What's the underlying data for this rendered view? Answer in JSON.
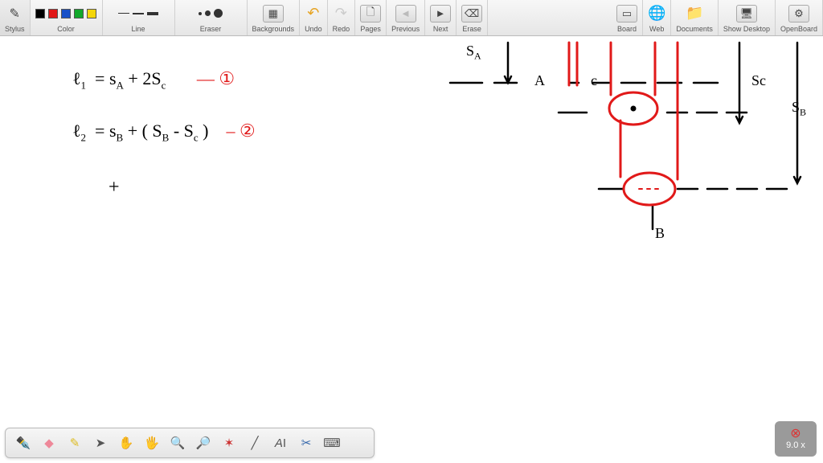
{
  "toolbar": {
    "stylus_label": "Stylus",
    "color_label": "Color",
    "line_label": "Line",
    "eraser_label": "Eraser",
    "backgrounds_label": "Backgrounds",
    "undo_label": "Undo",
    "redo_label": "Redo",
    "pages_label": "Pages",
    "previous_label": "Previous",
    "next_label": "Next",
    "erase_label": "Erase",
    "board_label": "Board",
    "web_label": "Web",
    "documents_label": "Documents",
    "show_desktop_label": "Show Desktop",
    "openboard_label": "OpenBoard"
  },
  "colors": {
    "swatches": [
      "#000000",
      "#e11919",
      "#1951c8",
      "#12a82a",
      "#f4d60a"
    ]
  },
  "zoom": {
    "value": "9.0 x"
  },
  "equations": {
    "line1_left": "ℓ",
    "line1_sub": "1",
    "line1_eq": "=   s",
    "line1_Asub": "A",
    "line1_rest": " + 2S",
    "line1_csub": "c",
    "line1_tag": "—  ①",
    "line2_left": "ℓ",
    "line2_sub": "2",
    "line2_eq": "=    s",
    "line2_Bsub": "B",
    "line2_rest": "  + ( S",
    "line2_B2": "B",
    "line2_minus": " - S",
    "line2_c2": "c",
    "line2_close": " )",
    "line2_tag": "– ②",
    "plus": "+"
  },
  "diagram": {
    "labels": {
      "SA": "S",
      "A_sub": "A",
      "A": "A",
      "C": "c",
      "SC": "Sc",
      "SB": "S",
      "B_sub": "B",
      "B": "B"
    }
  }
}
